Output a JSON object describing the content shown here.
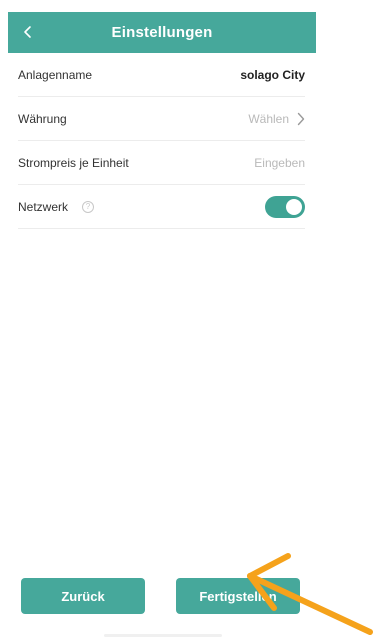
{
  "header": {
    "title": "Einstellungen",
    "back_icon": "chevron-left-icon"
  },
  "settings": {
    "rows": [
      {
        "label": "Anlagenname",
        "value": "solago City"
      },
      {
        "label": "Währung",
        "value": "Wählen"
      },
      {
        "label": "Strompreis je Einheit",
        "value": "Eingeben"
      },
      {
        "label": "Netzwerk",
        "toggle_on": true
      }
    ]
  },
  "footer": {
    "back_label": "Zurück",
    "finish_label": "Fertigstellen"
  },
  "colors": {
    "accent": "#46a89b",
    "annotation_arrow": "#f5a21b"
  }
}
